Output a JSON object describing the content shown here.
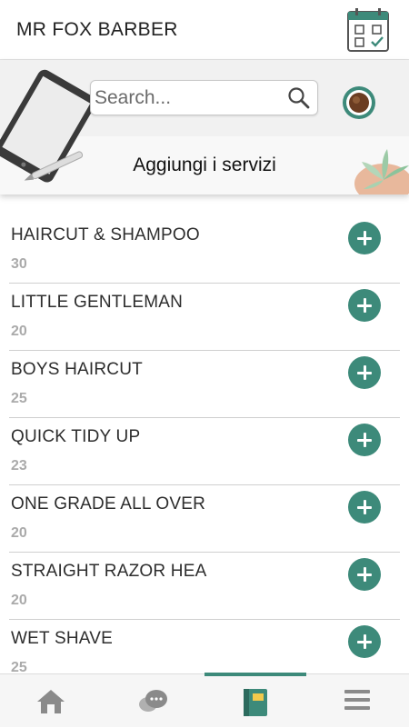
{
  "header": {
    "title": "MR FOX BARBER",
    "calendar_icon": "calendar-check-icon"
  },
  "search": {
    "placeholder": "Search..."
  },
  "section": {
    "title": "Aggiungi i servizi"
  },
  "services": [
    {
      "name": "HAIRCUT & SHAMPOO",
      "duration": "30"
    },
    {
      "name": "LITTLE GENTLEMAN",
      "duration": "20"
    },
    {
      "name": "BOYS HAIRCUT",
      "duration": "25"
    },
    {
      "name": "QUICK TIDY UP",
      "duration": "23"
    },
    {
      "name": "ONE GRADE ALL OVER",
      "duration": "20"
    },
    {
      "name": "STRAIGHT RAZOR HEA",
      "duration": "20"
    },
    {
      "name": "WET SHAVE",
      "duration": "25"
    }
  ],
  "tabs": [
    {
      "icon": "home-icon",
      "active": false
    },
    {
      "icon": "chat-icon",
      "active": false
    },
    {
      "icon": "book-icon",
      "active": true
    },
    {
      "icon": "menu-icon",
      "active": false
    }
  ],
  "colors": {
    "accent": "#3d8a7a",
    "duration": "#aaaaaa",
    "banner": "#f1f1f1"
  }
}
